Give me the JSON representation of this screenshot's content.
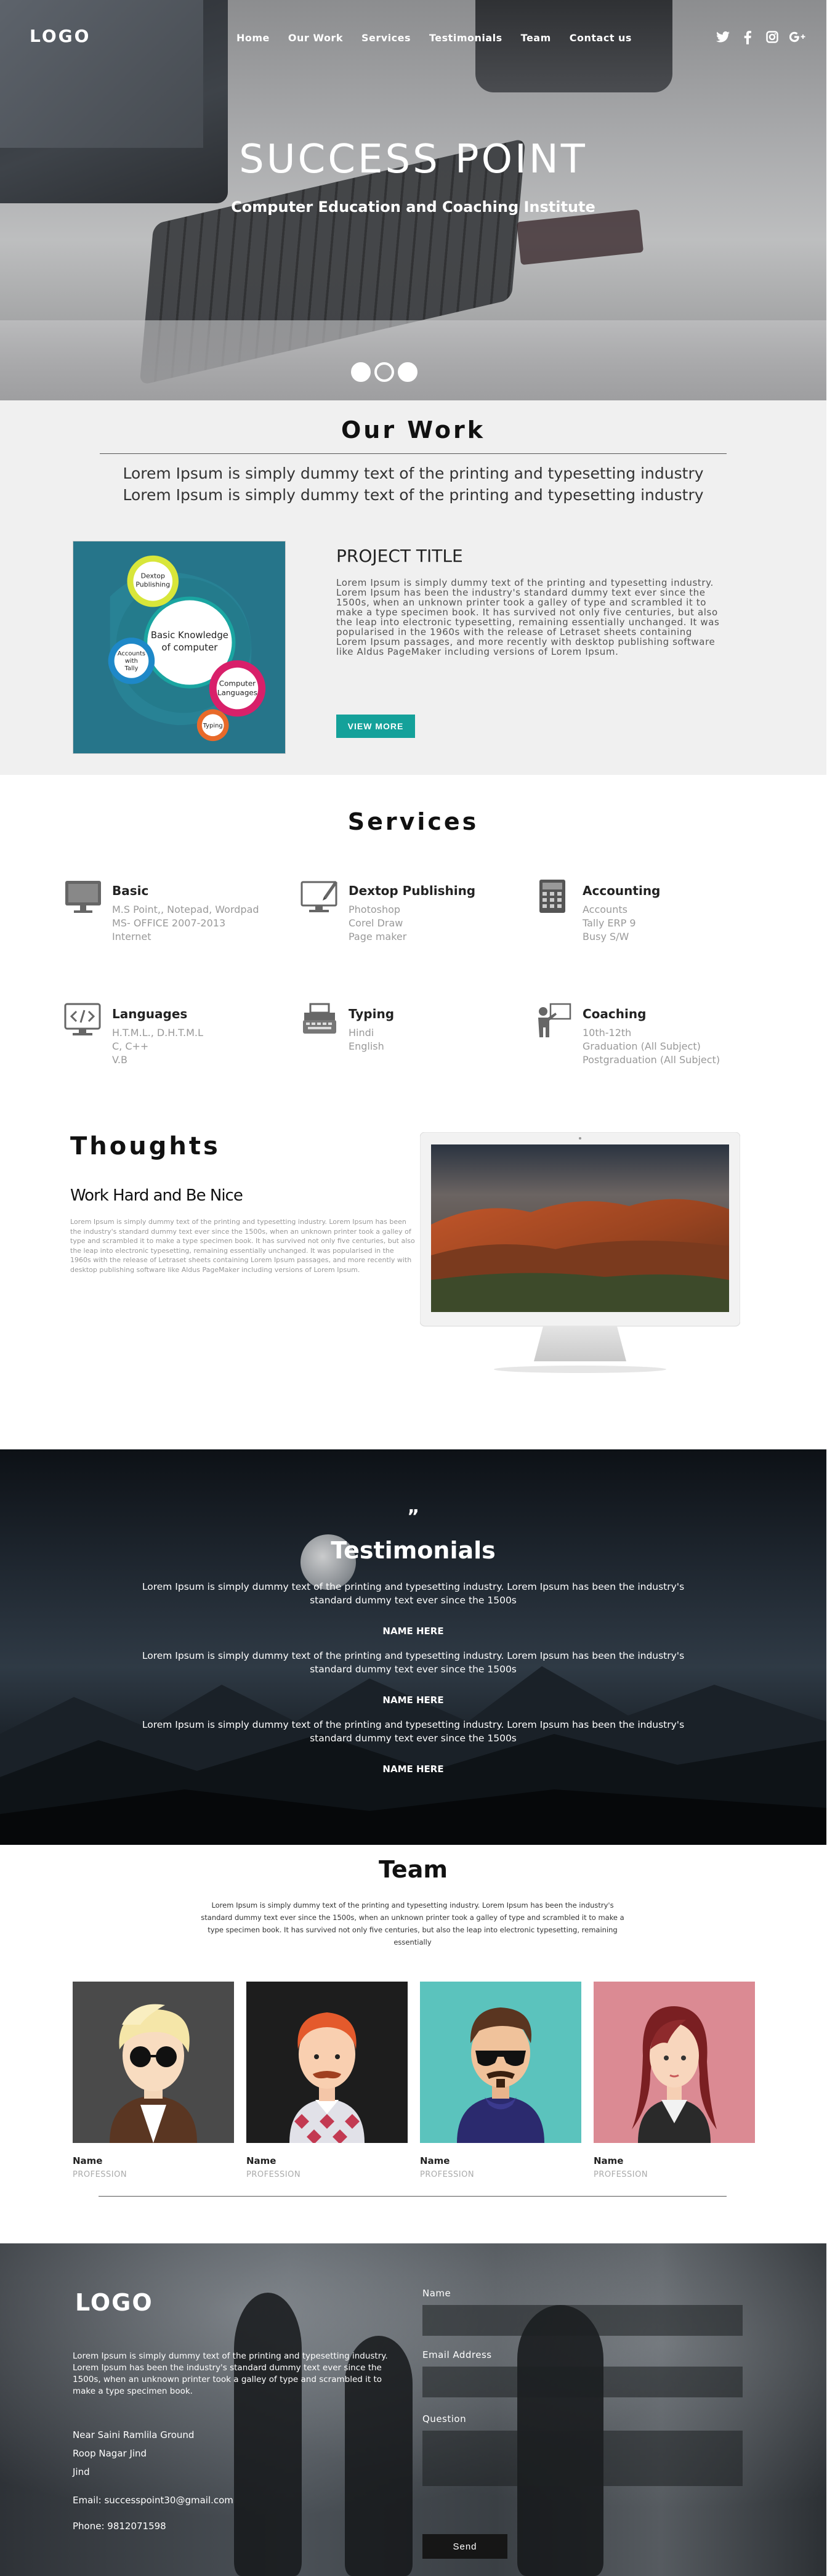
{
  "nav": {
    "logo": "LOGO",
    "items": [
      "Home",
      "Our Work",
      "Services",
      "Testimonials",
      "Team",
      "Contact us"
    ],
    "social": [
      "twitter-icon",
      "facebook-icon",
      "instagram-icon",
      "google-plus-icon"
    ]
  },
  "hero": {
    "title": "SUCCESS POINT",
    "subtitle": "Computer Education and Coaching Institute",
    "slides": 3,
    "active_slide": 2
  },
  "our_work": {
    "title": "Our Work",
    "lead_1": "Lorem Ipsum is simply dummy text of the printing and typesetting industry",
    "lead_2": "Lorem Ipsum is simply dummy text of the printing and typesetting industry",
    "illustration": {
      "center": "Basic Knowledge of computer",
      "top": "Dextop Publishing",
      "left": "Accounts with Tally",
      "right": "Computer Languages",
      "bottom": "Typing"
    },
    "project_title": "PROJECT TITLE",
    "project_text": "Lorem Ipsum is simply dummy text of the printing and typesetting industry. Lorem Ipsum has been the industry's standard dummy text ever since the 1500s, when an unknown printer took a galley of type and scrambled it to make a type specimen book. It has survived not only five centuries, but also the leap into electronic typesetting, remaining essentially unchanged. It was popularised in the 1960s with the release of Letraset sheets containing Lorem Ipsum passages, and more recently with desktop publishing software like Aldus PageMaker including versions of Lorem Ipsum.",
    "button": "VIEW MORE"
  },
  "services": {
    "title": "Services",
    "items": [
      {
        "name": "Basic",
        "icon": "desktop-icon",
        "lines": [
          "M.S Point,, Notepad, Wordpad",
          "MS- OFFICE 2007-2013",
          "Internet"
        ]
      },
      {
        "name": "Dextop Publishing",
        "icon": "monitor-pen-icon",
        "lines": [
          "Photoshop",
          "Corel Draw",
          "Page maker"
        ]
      },
      {
        "name": "Accounting",
        "icon": "calculator-icon",
        "lines": [
          "Accounts",
          "Tally ERP 9",
          "Busy S/W"
        ]
      },
      {
        "name": "Languages",
        "icon": "code-icon",
        "lines": [
          "H.T.M.L., D.H.T.M.L",
          "C, C++",
          "V.B"
        ]
      },
      {
        "name": "Typing",
        "icon": "typewriter-icon",
        "lines": [
          "Hindi",
          "English"
        ]
      },
      {
        "name": "Coaching",
        "icon": "teacher-icon",
        "lines": [
          "10th-12th",
          "Graduation (All Subject)",
          "Postgraduation (All Subject)"
        ]
      }
    ]
  },
  "thoughts": {
    "title": "Thoughts",
    "subtitle": "Work Hard and Be Nice",
    "text": "Lorem Ipsum is simply dummy text of the printing and typesetting industry. Lorem Ipsum has been the industry's standard dummy text ever since the 1500s, when an unknown printer took a galley of type and scrambled it to make a type specimen book. It has survived not only five centuries, but also the leap into electronic typesetting, remaining essentially unchanged. It was popularised in the 1960s with the release of Letraset sheets containing Lorem Ipsum passages, and more recently with desktop publishing software like Aldus PageMaker including versions of Lorem Ipsum."
  },
  "testimonials": {
    "quote_mark": "”",
    "title": "Testimonials",
    "items": [
      {
        "text": "Lorem Ipsum is simply dummy text of the printing and typesetting industry. Lorem Ipsum has been the industry's standard dummy text ever since the 1500s",
        "name": "NAME HERE"
      },
      {
        "text": "Lorem Ipsum is simply dummy text of the printing and typesetting industry. Lorem Ipsum has been the industry's standard dummy text ever since the 1500s",
        "name": "NAME HERE"
      },
      {
        "text": "Lorem Ipsum is simply dummy text of the printing and typesetting industry. Lorem Ipsum has been the industry's standard dummy text ever since the 1500s",
        "name": "NAME HERE"
      }
    ]
  },
  "team": {
    "title": "Team",
    "intro": "Lorem Ipsum is simply dummy text of the printing and typesetting industry. Lorem Ipsum has been the industry's standard dummy text ever since the 1500s, when an unknown printer took a galley of type and scrambled it to make a type specimen book. It has survived not only five centuries, but also the leap into electronic typesetting, remaining essentially",
    "members": [
      {
        "name": "Name",
        "profession": "PROFESSION",
        "bg": "#4a4a4a"
      },
      {
        "name": "Name",
        "profession": "PROFESSION",
        "bg": "#1d1d1d"
      },
      {
        "name": "Name",
        "profession": "PROFESSION",
        "bg": "#5bc3bd"
      },
      {
        "name": "Name",
        "profession": "PROFESSION",
        "bg": "#db8a93"
      }
    ]
  },
  "footer": {
    "logo": "LOGO",
    "about": "Lorem Ipsum is simply dummy text of the printing and typesetting industry. Lorem Ipsum has been the industry's standard dummy text ever since the 1500s, when an unknown printer took a galley of type and scrambled it to make a type specimen book.",
    "address": [
      "Near Saini Ramlila Ground",
      "Roop Nagar Jind",
      "Jind"
    ],
    "email": "Email: successpoint30@gmail.com",
    "phone": "Phone: 9812071598",
    "form": {
      "name_label": "Name",
      "email_label": "Email Address",
      "question_label": "Question",
      "send": "Send"
    }
  },
  "colors": {
    "accent": "#14a19a",
    "illustration_bg": "#26758a"
  }
}
